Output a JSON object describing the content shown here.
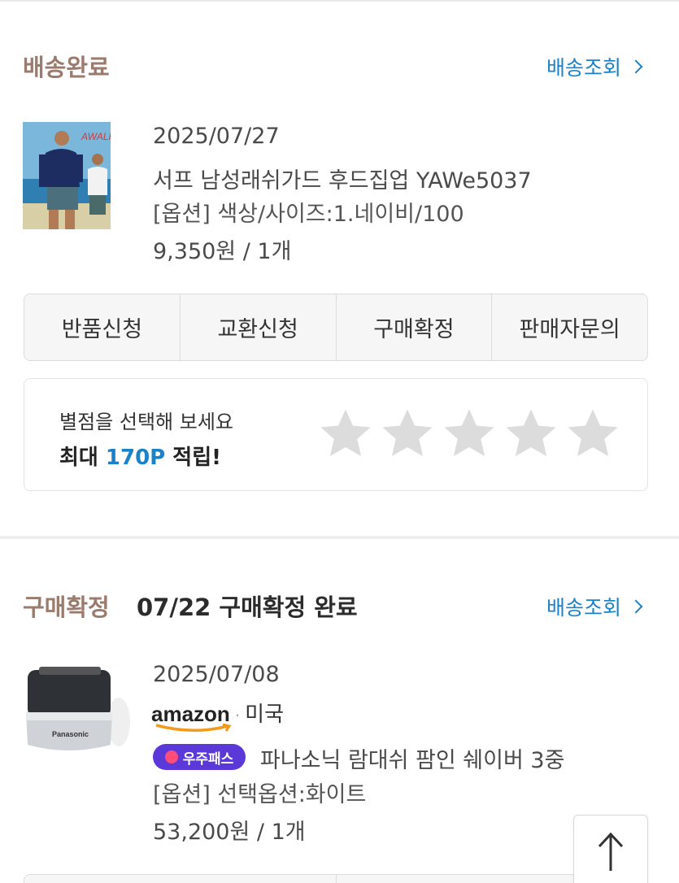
{
  "order1": {
    "status": "배송완료",
    "track_label": "배송조회",
    "date": "2025/07/27",
    "product_name": "서프 남성래쉬가드 후드집업 YAWe5037",
    "option": "[옵션] 색상/사이즈:1.네이비/100",
    "price_qty": "9,350원 / 1개",
    "thumb_brand_text": "AWALK",
    "actions": [
      "반품신청",
      "교환신청",
      "구매확정",
      "판매자문의"
    ],
    "review": {
      "prompt": "별점을 선택해 보세요",
      "reward_prefix": "최대 ",
      "reward_points": "170P",
      "reward_suffix": " 적립!",
      "star_count": 5,
      "rating": 0
    }
  },
  "order2": {
    "status": "구매확정",
    "status_note": "07/22 구매확정 완료",
    "track_label": "배송조회",
    "date": "2025/07/08",
    "store_logo": "amazon",
    "store_country": "미국",
    "badge": "우주패스",
    "product_name": "파나소닉 람대쉬 팜인 쉐이버 3중",
    "option": "[옵션] 선택옵션:화이트",
    "price_qty": "53,200원 / 1개",
    "thumb_brand_text": "Panasonic"
  },
  "colors": {
    "status": "#9a7b6d",
    "link": "#1a82c9",
    "badge": "#5b39d8",
    "star": "#dcdcdc"
  },
  "icons": {
    "track_chevron": "chevron-right-icon",
    "scroll_top": "arrow-up-icon",
    "star": "star-icon"
  }
}
